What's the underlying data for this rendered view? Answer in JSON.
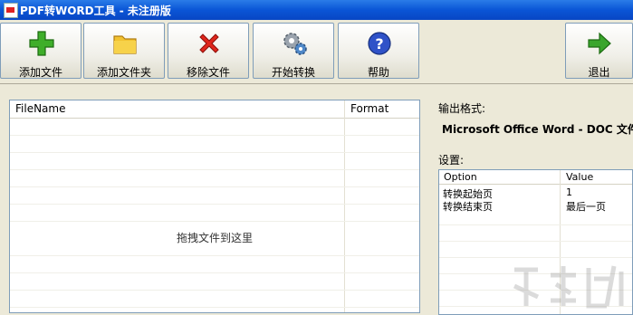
{
  "window": {
    "title": "PDF转WORD工具 - 未注册版"
  },
  "toolbar": {
    "add_file": "添加文件",
    "add_folder": "添加文件夹",
    "remove_file": "移除文件",
    "start_convert": "开始转换",
    "help": "帮助",
    "exit": "退出"
  },
  "file_list": {
    "columns": [
      "FileName",
      "Format"
    ],
    "drop_hint": "拖拽文件到这里"
  },
  "output": {
    "label": "输出格式:",
    "value": "Microsoft Office Word - DOC 文件"
  },
  "settings": {
    "label": "设置:",
    "columns": [
      "Option",
      "Value"
    ],
    "rows": [
      {
        "option": "转换起始页",
        "value": "1"
      },
      {
        "option": "转换结束页",
        "value": "最后一页"
      }
    ]
  }
}
